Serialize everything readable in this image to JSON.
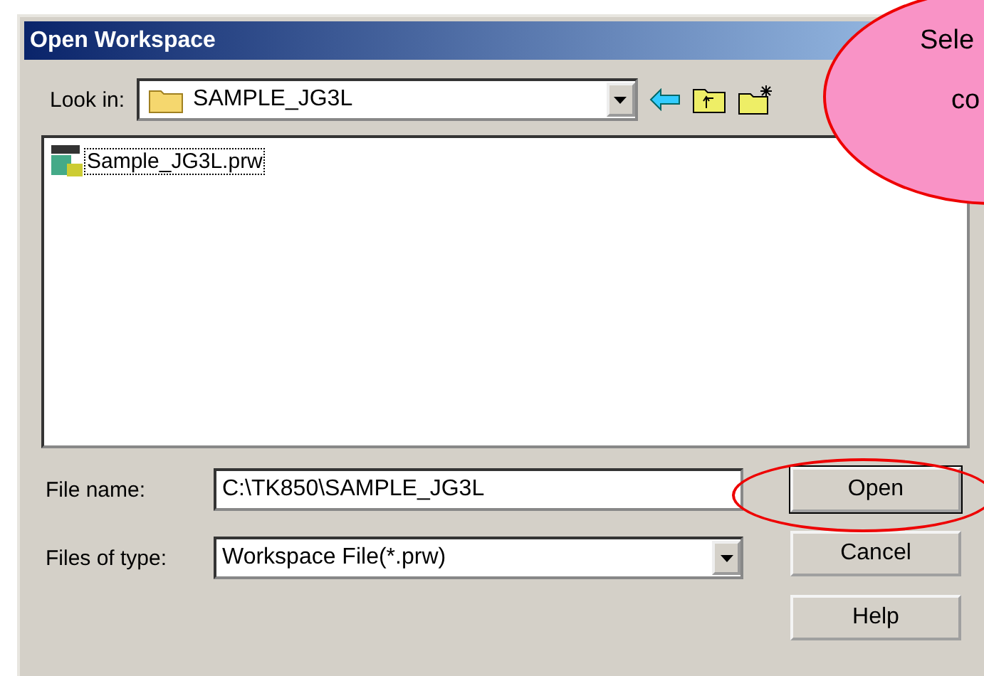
{
  "window": {
    "title": "Open Workspace"
  },
  "look_in": {
    "label": "Look in:",
    "value": "SAMPLE_JG3L"
  },
  "files": [
    {
      "name": "Sample_JG3L.prw",
      "selected": true
    }
  ],
  "file_name": {
    "label": "File name:",
    "value": "C:\\TK850\\SAMPLE_JG3L"
  },
  "file_type": {
    "label": "Files of type:",
    "value": "Workspace File(*.prw)"
  },
  "buttons": [
    {
      "label": "Open",
      "highlighted": true
    },
    {
      "label": "Cancel",
      "highlighted": false
    },
    {
      "label": "Help",
      "highlighted": false
    }
  ],
  "callout": {
    "lines": [
      "Sele",
      "co"
    ]
  }
}
